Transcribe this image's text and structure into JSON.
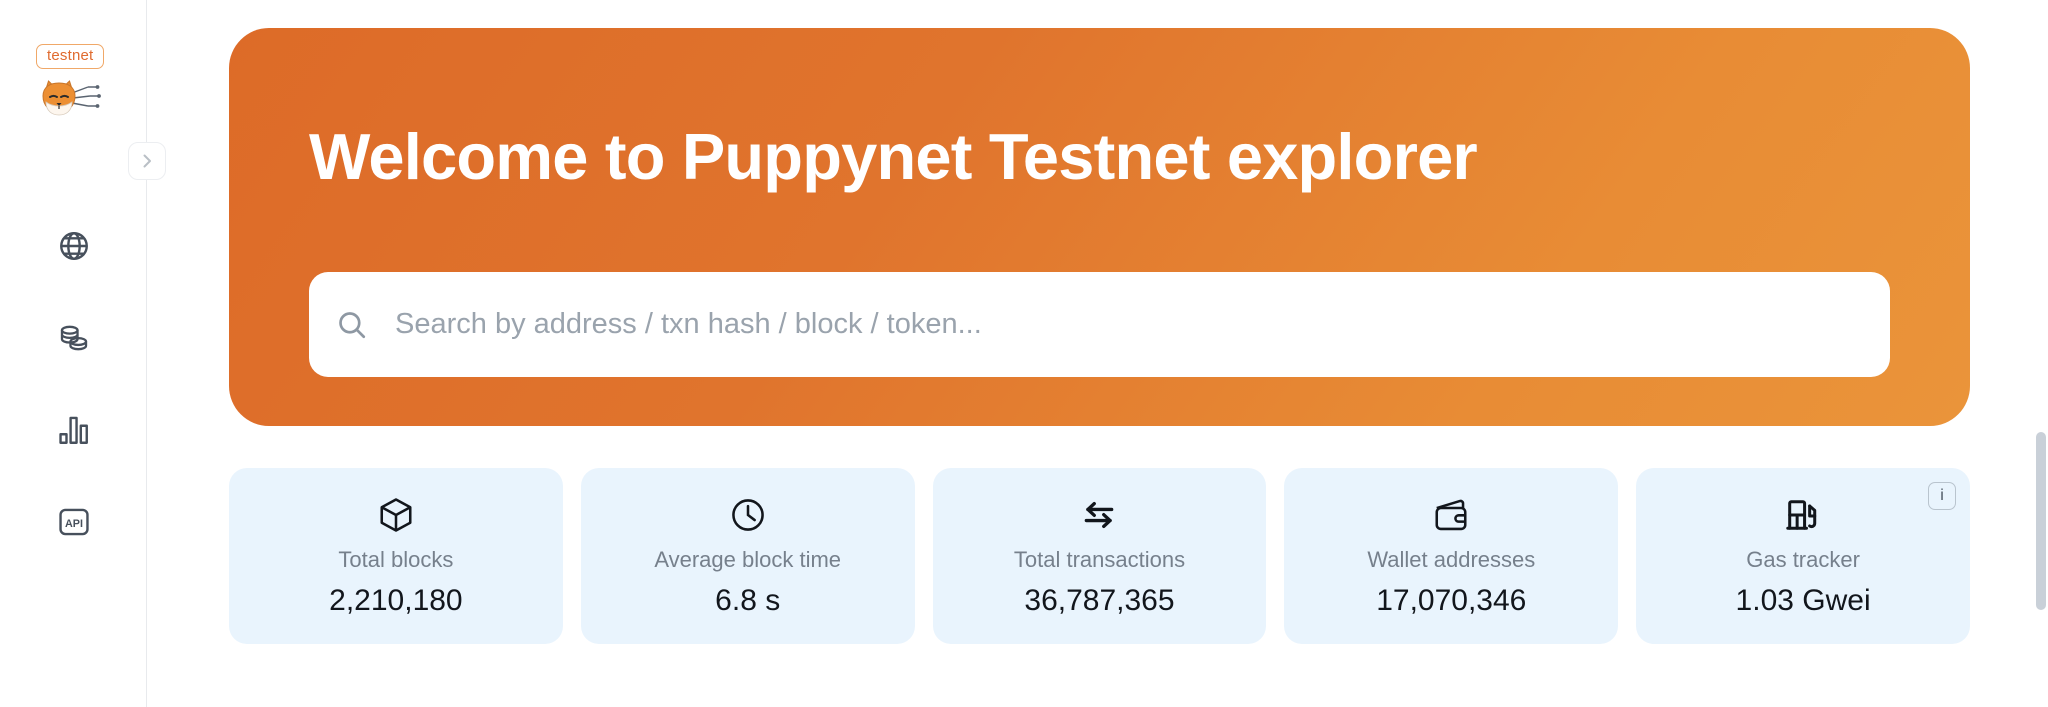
{
  "sidebar": {
    "network_badge": "testnet",
    "logo_name": "shiba-inu-logo",
    "collapse_toggle_icon": "chevron-right-icon",
    "items": [
      {
        "id": "blockchain",
        "label": "Blockchain",
        "icon": "globe-icon"
      },
      {
        "id": "tokens",
        "label": "Tokens",
        "icon": "coins-icon"
      },
      {
        "id": "charts-stats",
        "label": "Charts & stats",
        "icon": "bar-chart-icon"
      },
      {
        "id": "api",
        "label": "API",
        "icon": "api-icon"
      }
    ]
  },
  "hero": {
    "title": "Welcome to Puppynet Testnet explorer",
    "gradient_from": "#dd6b28",
    "gradient_to": "#ea943a"
  },
  "search": {
    "icon": "search-icon",
    "placeholder": "Search by address / txn hash / block / token...",
    "value": ""
  },
  "stats": {
    "card_bg": "#e9f4fd",
    "items": [
      {
        "icon": "cube-icon",
        "label": "Total blocks",
        "value": "2,210,180",
        "has_info": false
      },
      {
        "icon": "clock-icon",
        "label": "Average block time",
        "value": "6.8 s",
        "has_info": false
      },
      {
        "icon": "transactions-icon",
        "label": "Total transactions",
        "value": "36,787,365",
        "has_info": false
      },
      {
        "icon": "wallet-icon",
        "label": "Wallet addresses",
        "value": "17,070,346",
        "has_info": false
      },
      {
        "icon": "gas-pump-icon",
        "label": "Gas tracker",
        "value": "1.03 Gwei",
        "has_info": true,
        "info_label": "i"
      }
    ]
  },
  "scrollbar": {
    "name": "page-scrollbar"
  }
}
